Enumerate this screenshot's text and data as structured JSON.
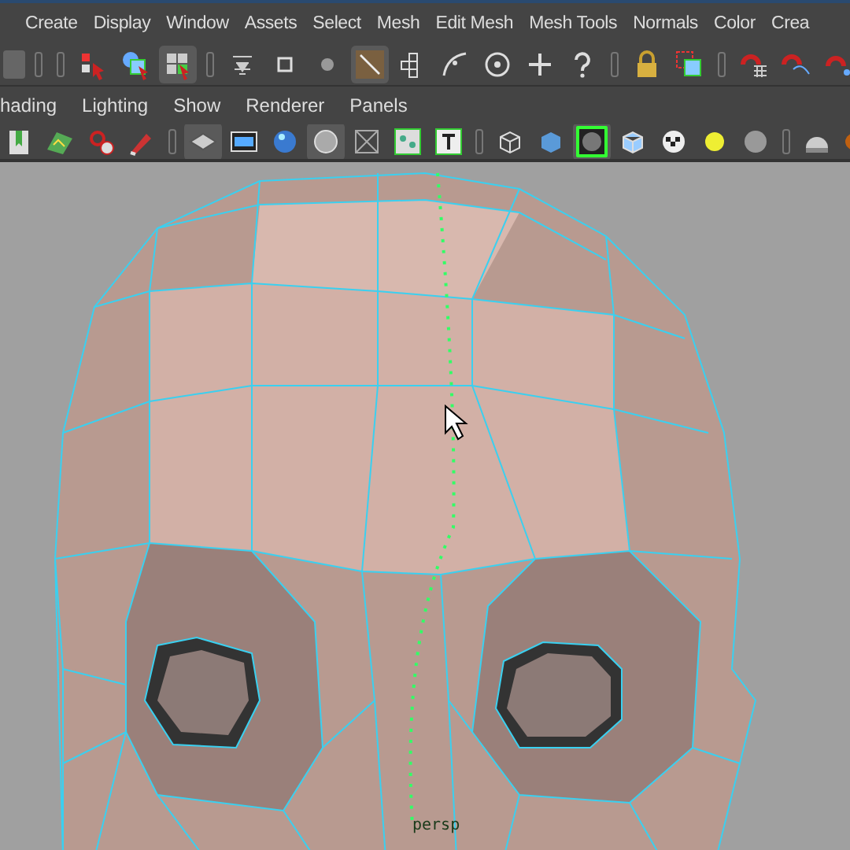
{
  "main_menu": [
    "Create",
    "Display",
    "Window",
    "Assets",
    "Select",
    "Mesh",
    "Edit Mesh",
    "Mesh Tools",
    "Normals",
    "Color",
    "Crea"
  ],
  "panel_menu": [
    "hading",
    "Lighting",
    "Show",
    "Renderer",
    "Panels"
  ],
  "viewport": {
    "camera_label": "persp"
  }
}
